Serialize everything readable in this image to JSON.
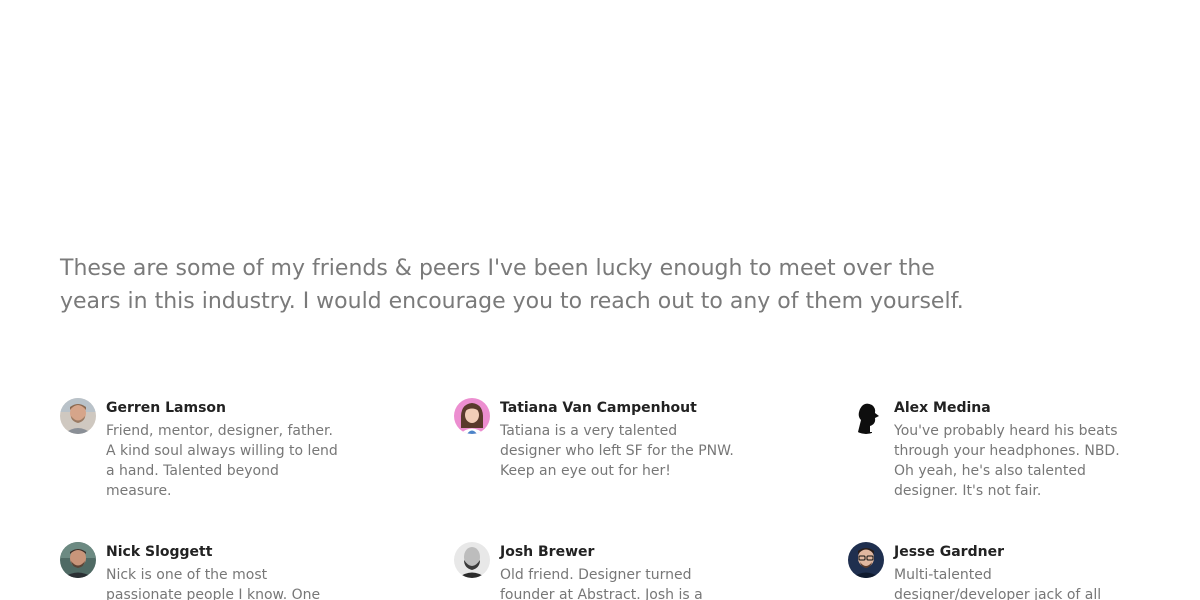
{
  "intro": {
    "text": "These are some of my friends & peers I've been lucky enough to meet over the years in this industry. I would encourage you to reach out to any of them yourself."
  },
  "people": [
    {
      "name": "Gerren Lamson",
      "description": "Friend, mentor, designer, father. A kind soul always willing to lend a hand. Talented beyond measure.",
      "avatar": "gerren-lamson-avatar"
    },
    {
      "name": "Tatiana Van Campenhout",
      "description": "Tatiana is a very talented designer who left SF for the PNW. Keep an eye out for her!",
      "avatar": "tatiana-van-campenhout-avatar"
    },
    {
      "name": "Alex Medina",
      "description": "You've probably heard his beats through your headphones. NBD. Oh yeah, he's also talented designer. It's not fair.",
      "avatar": "alex-medina-avatar"
    },
    {
      "name": "Nick Sloggett",
      "description": "Nick is one of the most passionate people I know. One",
      "avatar": "nick-sloggett-avatar"
    },
    {
      "name": "Josh Brewer",
      "description": "Old friend. Designer turned founder at Abstract. Josh is a",
      "avatar": "josh-brewer-avatar"
    },
    {
      "name": "Jesse Gardner",
      "description": "Multi-talented designer/developer jack of all",
      "avatar": "jesse-gardner-avatar"
    }
  ]
}
